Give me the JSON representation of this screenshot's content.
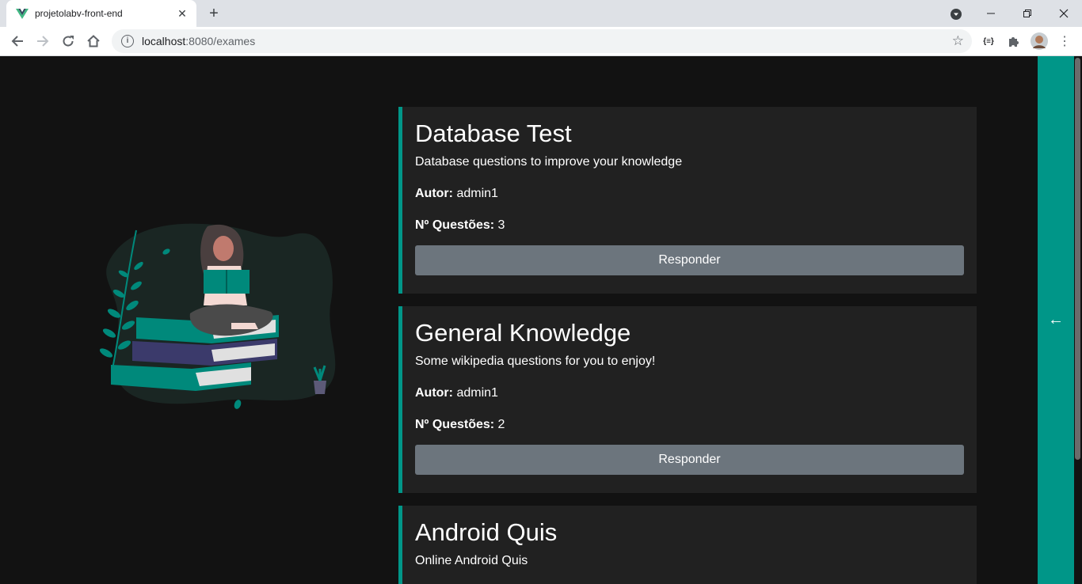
{
  "browser": {
    "tab_title": "projetolabv-front-end",
    "url_host": "localhost",
    "url_path": ":8080/exames",
    "extension_label": "{≡}"
  },
  "exams": [
    {
      "title": "Database Test",
      "description": "Database questions to improve your knowledge",
      "author_label": "Autor:",
      "author": "admin1",
      "questions_label": "Nº Questões:",
      "questions": "3",
      "button_label": "Responder"
    },
    {
      "title": "General Knowledge",
      "description": "Some wikipedia questions for you to enjoy!",
      "author_label": "Autor:",
      "author": "admin1",
      "questions_label": "Nº Questões:",
      "questions": "2",
      "button_label": "Responder"
    },
    {
      "title": "Android Quis",
      "description": "Online Android Quis"
    }
  ],
  "side_panel": {
    "icon": "arrow-left-icon",
    "glyph": "←"
  },
  "colors": {
    "accent": "#009688",
    "card": "#212121",
    "background": "#121212",
    "button": "#6c757d"
  }
}
